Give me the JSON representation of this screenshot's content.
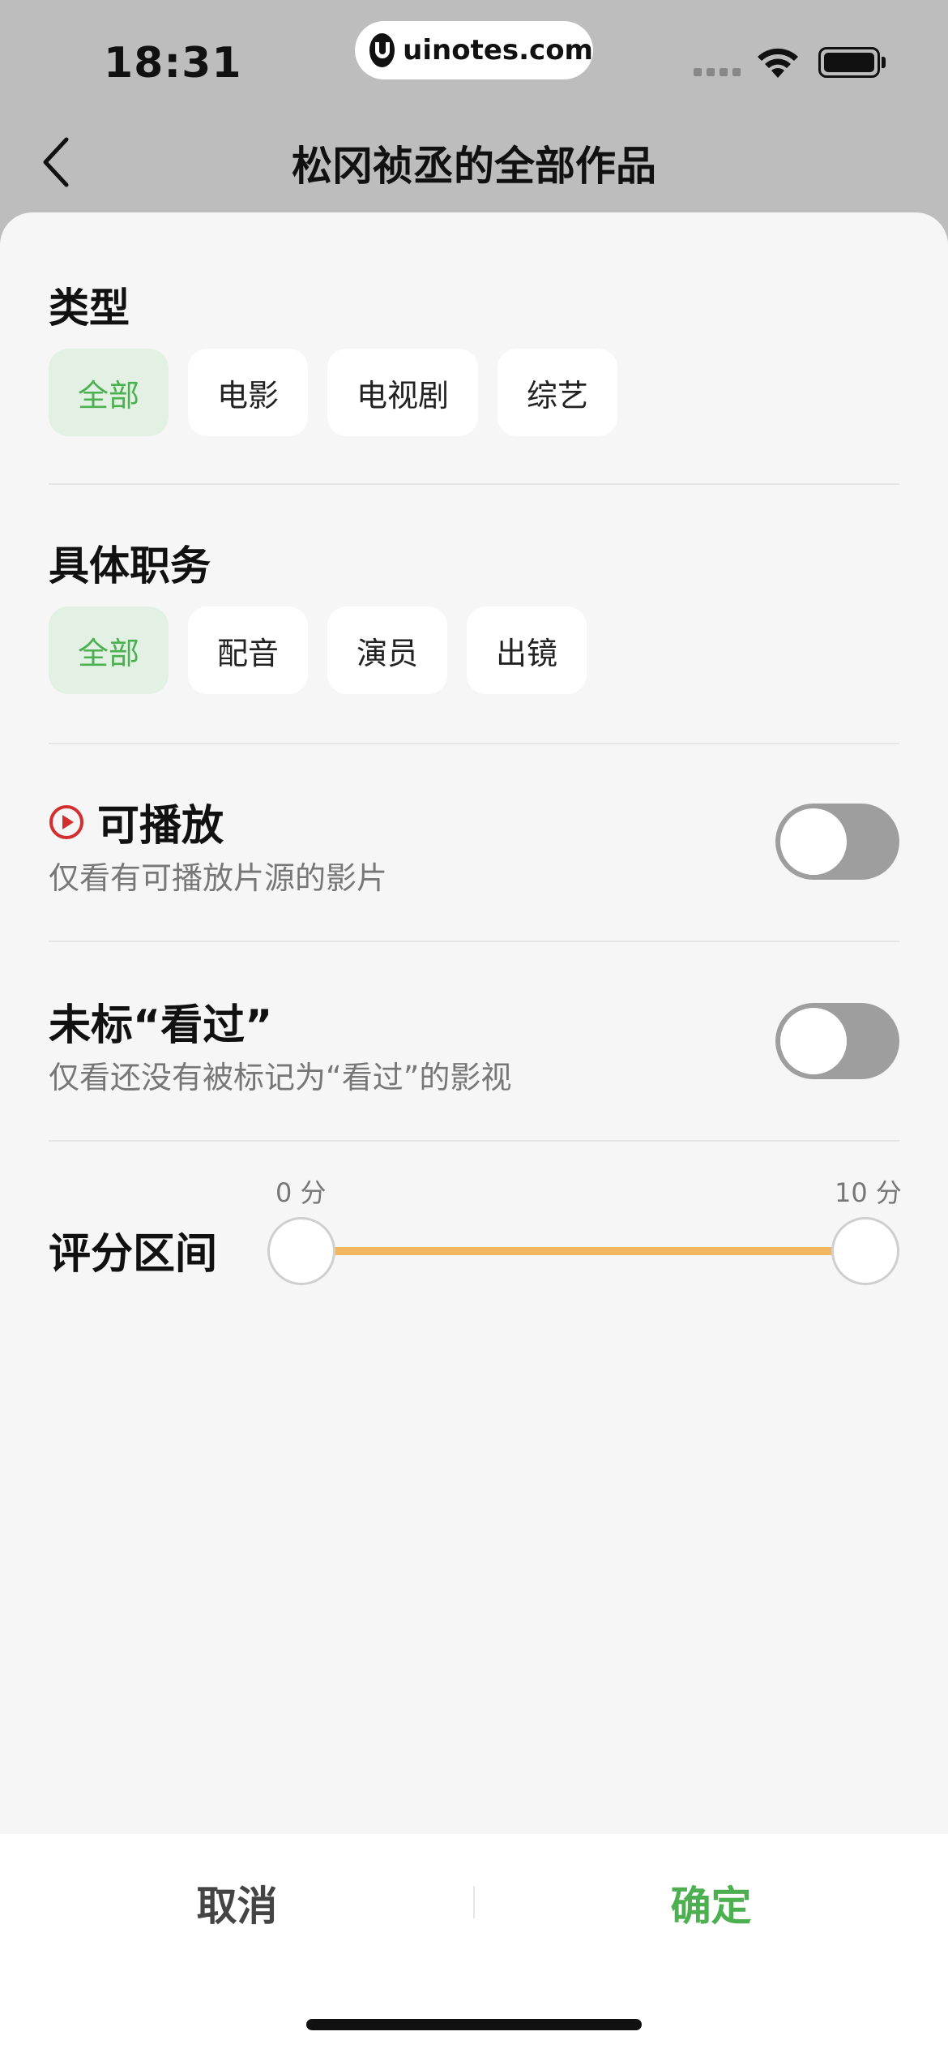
{
  "status_bar": {
    "time": "18:31",
    "url": "uinotes.com"
  },
  "nav": {
    "title": "松冈祯丞的全部作品",
    "back_icon": "chevron-left-icon"
  },
  "type_section": {
    "title": "类型",
    "options": [
      "全部",
      "电影",
      "电视剧",
      "综艺"
    ],
    "selected": "全部"
  },
  "role_section": {
    "title": "具体职务",
    "options": [
      "全部",
      "配音",
      "演员",
      "出镜"
    ],
    "selected": "全部"
  },
  "playable": {
    "icon": "play-circle-icon",
    "title": "可播放",
    "subtitle": "仅看有可播放片源的影片",
    "enabled": false
  },
  "unwatched": {
    "title": "未标“看过”",
    "subtitle": "仅看还没有被标记为“看过”的影视",
    "enabled": false
  },
  "rating": {
    "label": "评分区间",
    "min_label": "0 分",
    "max_label": "10 分",
    "min": 0,
    "max": 10,
    "accent": "#f2b65e"
  },
  "footer": {
    "cancel": "取消",
    "confirm": "确定"
  },
  "colors": {
    "accent_green": "#4caf50",
    "chip_active_bg": "#e3f1e5",
    "play_icon": "#d32f2f"
  }
}
